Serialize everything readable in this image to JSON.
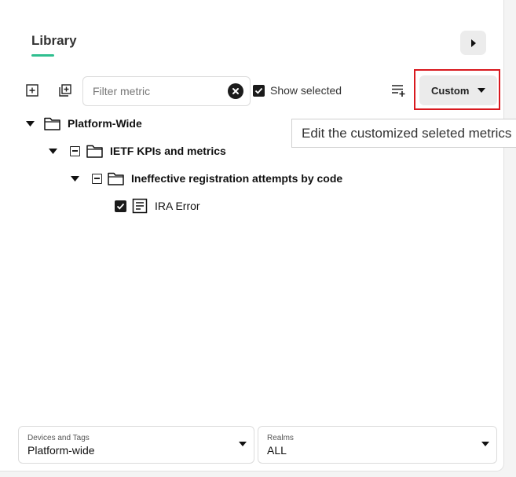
{
  "library": {
    "title": "Library",
    "accent_color": "#2fbf8f"
  },
  "toolbar": {
    "expand_all_icon": "plus-square-icon",
    "copy_icon": "copy-plus-icon",
    "filter": {
      "placeholder": "Filter metric",
      "value": ""
    },
    "show_selected_label": "Show selected",
    "show_selected_checked": true,
    "add_list_icon": "playlist-add-icon",
    "custom_label": "Custom"
  },
  "tooltip": {
    "text": "Edit the customized seleted metrics"
  },
  "tree": [
    {
      "label": "Platform-Wide",
      "type": "folder",
      "expanded": true
    },
    {
      "label": "IETF KPIs and metrics",
      "type": "folder",
      "expanded": true
    },
    {
      "label": "Ineffective registration attempts by code",
      "type": "folder",
      "expanded": true
    },
    {
      "label": "IRA Error",
      "type": "metric",
      "checked": true
    }
  ],
  "footer": {
    "devices": {
      "label": "Devices and Tags",
      "value": "Platform-wide"
    },
    "realms": {
      "label": "Realms",
      "value": "ALL"
    }
  },
  "colors": {
    "highlight": "#d9191f"
  }
}
